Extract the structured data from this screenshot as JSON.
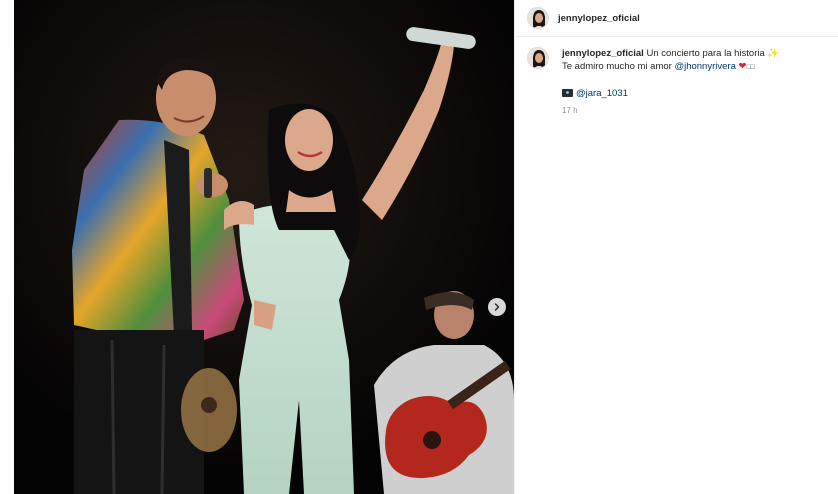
{
  "post": {
    "username": "jennylopez_oficial",
    "caption_user": "jennylopez_oficial",
    "caption_text": "Un concierto para la historia",
    "caption_emoji": "✨",
    "line2_text": "Te admiro mucho mi amor ",
    "line2_mention": "@jhonnyrivera",
    "line2_heart": "❤",
    "line2_tail": "□□",
    "photo_credit_mention": "@jara_1031",
    "timestamp": "17 h"
  },
  "icons": {
    "next": "chevron-right-icon",
    "camera": "camera-icon",
    "heart": "heart-icon"
  },
  "colors": {
    "mention": "#00376b",
    "heart": "#e0242d",
    "muted": "#8e8e8e",
    "photo_bg": "#070606"
  }
}
